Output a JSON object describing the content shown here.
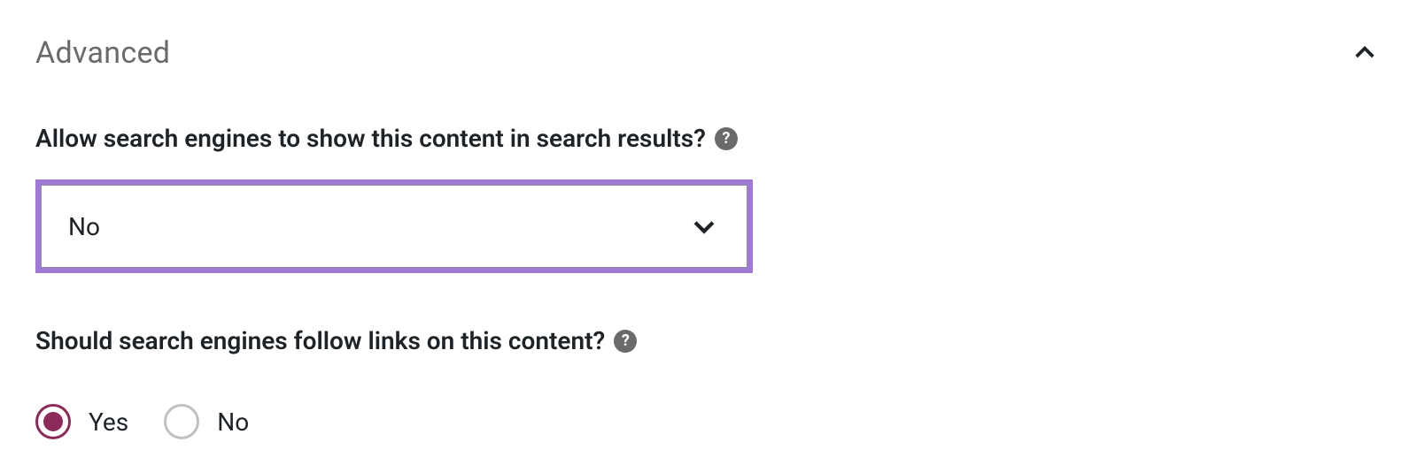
{
  "section": {
    "title": "Advanced"
  },
  "allow_search": {
    "label": "Allow search engines to show this content in search results?",
    "help_glyph": "?",
    "selected_value": "No"
  },
  "follow_links": {
    "label": "Should search engines follow links on this content?",
    "help_glyph": "?",
    "options": {
      "yes": "Yes",
      "no": "No"
    },
    "selected": "yes"
  }
}
